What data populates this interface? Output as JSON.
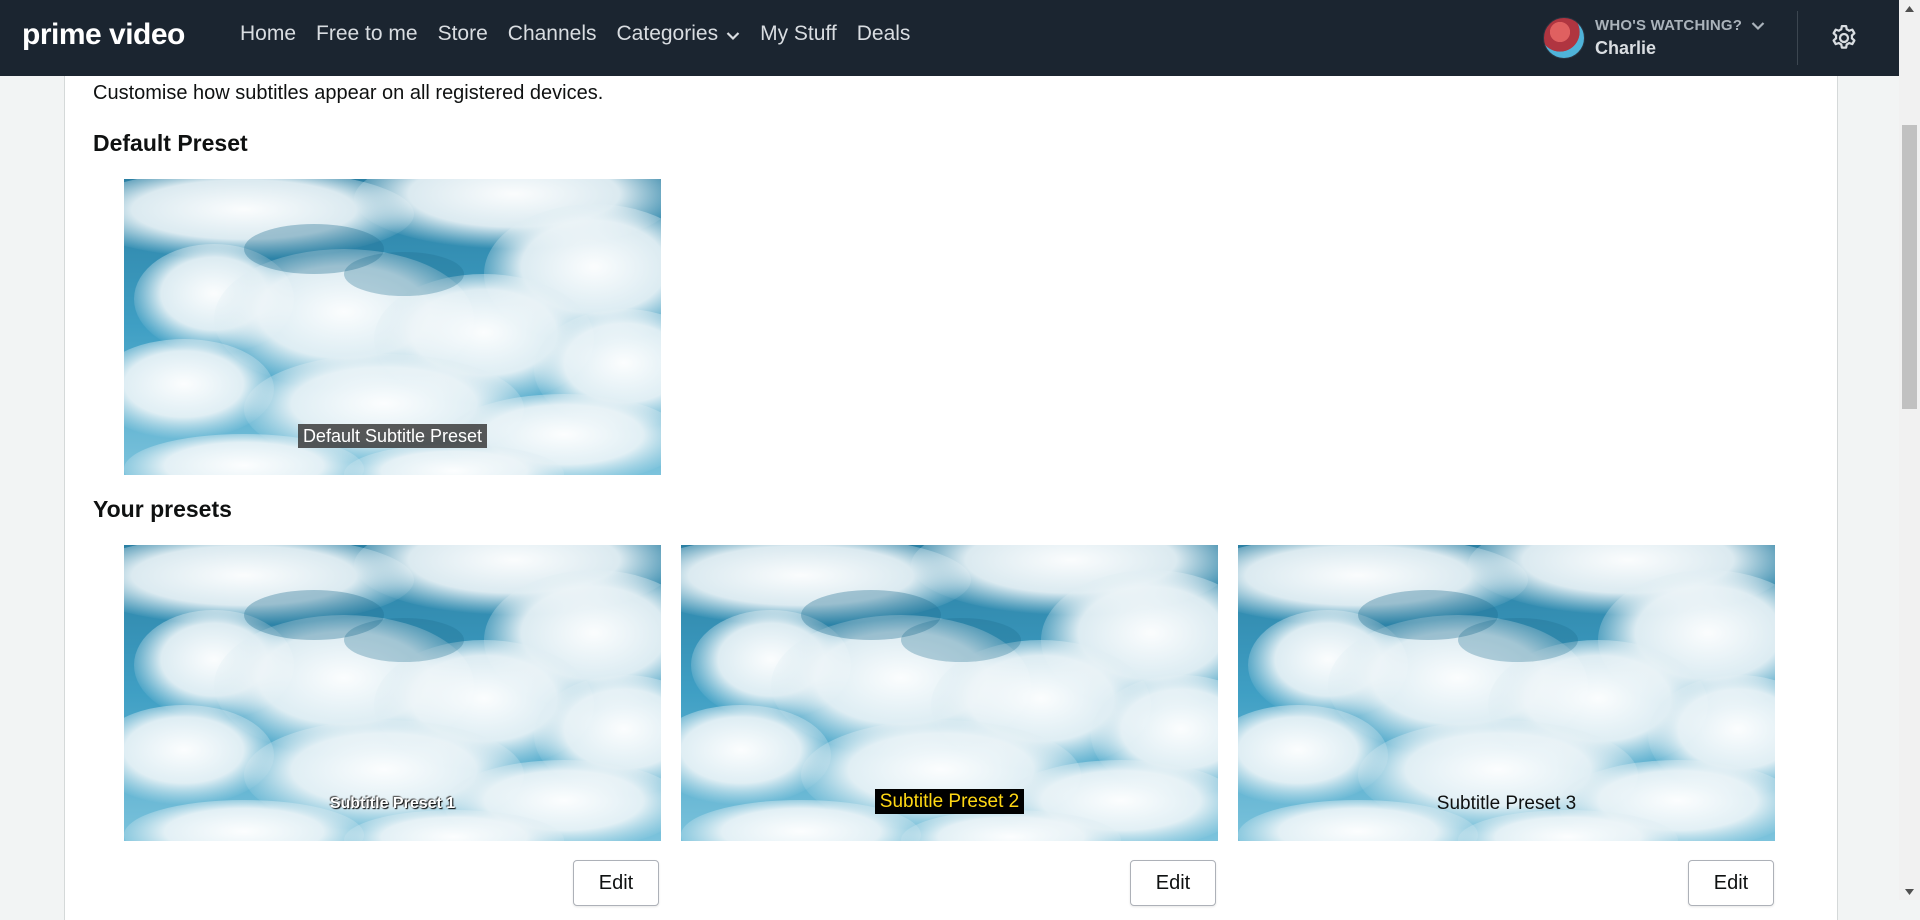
{
  "nav": {
    "logo": "prime video",
    "links": [
      "Home",
      "Free to me",
      "Store",
      "Channels",
      "Categories",
      "My Stuff",
      "Deals"
    ],
    "profile_prompt": "WHO'S WATCHING?",
    "profile_name": "Charlie"
  },
  "content": {
    "intro": "Customise how subtitles appear on all registered devices.",
    "default_heading": "Default Preset",
    "default_caption": "Default Subtitle Preset",
    "presets_heading": "Your presets",
    "presets": [
      {
        "caption": "Subtitle Preset 1",
        "edit_label": "Edit"
      },
      {
        "caption": "Subtitle Preset 2",
        "edit_label": "Edit"
      },
      {
        "caption": "Subtitle Preset 3",
        "edit_label": "Edit"
      }
    ]
  },
  "icons": {
    "chevron": "chevron-down-icon",
    "settings": "gear-icon",
    "avatar": "avatar"
  },
  "colors": {
    "nav_bg": "#1b2530",
    "page_bg": "#f2f4f4",
    "card_bg": "#ffffff",
    "preset2_text": "#ffd814"
  }
}
